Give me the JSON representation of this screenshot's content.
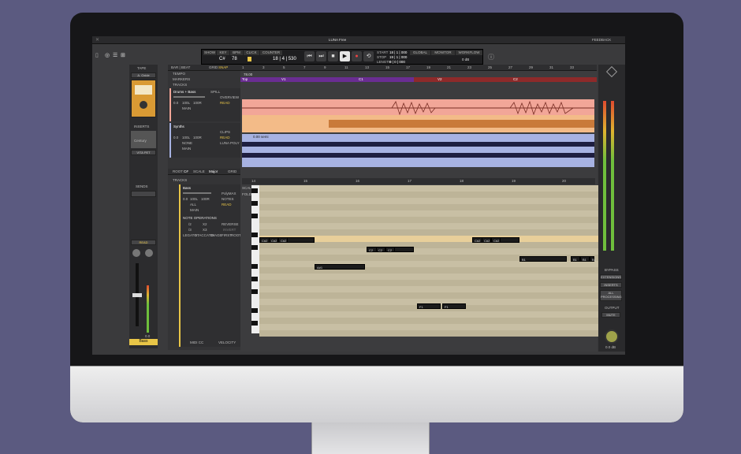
{
  "app": {
    "title": "LUNA Free",
    "feedback": "FEEDBACK"
  },
  "toolbar": {
    "tabs": [
      "SHOW",
      "KEY",
      "BPM",
      "CLICK",
      "COUNTER",
      "GLOBAL",
      "MONITOR",
      "WORKFLOW"
    ],
    "key": "C#",
    "bpm": "78",
    "counter": "18 | 4 | 530",
    "start_label": "START",
    "start_val": "18 | 1 | 000",
    "stop_label": "STOP",
    "stop_val": "19 | 1 | 000",
    "length_label": "LENGTH",
    "length_val": "0 | 0 | 000",
    "db": "0 dB"
  },
  "tape": {
    "label": "TAPE",
    "preset": "A. Oxide",
    "inserts": "INSERTS",
    "insert_name": "Century",
    "insert_sub": "VITA PET",
    "sends": "SENDS",
    "read": "READ",
    "track_name": "Bass",
    "value": "0.0"
  },
  "timeline": {
    "mode": "BAR | BEAT",
    "grid": "GRID",
    "snap": "SNAP",
    "bars_top": [
      "1",
      "3",
      "5",
      "7",
      "9",
      "11",
      "13",
      "15",
      "17",
      "19",
      "21",
      "23",
      "25",
      "27",
      "29",
      "31",
      "33"
    ],
    "tempo_label": "TEMPO",
    "tempo_val": "78.00",
    "markers_label": "MARKERS",
    "markers": [
      "Top",
      "V1",
      "C1",
      "V2",
      "C2"
    ],
    "tracks_label": "TRACKS"
  },
  "tracks": [
    {
      "name": "Drums + Bass",
      "spill": "SPILL",
      "view": "OVERVIEW",
      "auto": "READ",
      "out": "MAIN",
      "vol": "0.0",
      "pan": "100L",
      "pan2": "100R"
    },
    {
      "name": "Synths",
      "view": "CLIPS",
      "auto": "READ",
      "warp": "LUNA POLY",
      "vol": "0.0",
      "pan": "100L",
      "pan2": "100R",
      "in": "NONE",
      "out": "MAIN",
      "clip": "0.00 semi"
    }
  ],
  "editor": {
    "root_label": "ROOT",
    "root": "C#",
    "scale_label": "SCALE",
    "scale": "Major",
    "grid": "GRID",
    "grid_val": "16",
    "tracks": "TRACKS",
    "fold": "FOLD",
    "scale_btn": "SCALE",
    "bars": [
      "14",
      "15",
      "16",
      "17",
      "18",
      "19",
      "20"
    ],
    "track_name": "Bass",
    "instr": "PolyMAX",
    "view": "NOTES",
    "auto": "READ",
    "vol": "0.0",
    "pan": "100L",
    "pan2": "100R",
    "midi": "ALL",
    "out": "MAIN",
    "note_ops": "NOTE OPERATIONS",
    "reverse": "REVERSE",
    "invert": "INVERT",
    "ops_row": [
      "LEGATO",
      "STACCATO",
      "IMAGE",
      "FIRST",
      "ROOT"
    ],
    "x2": "X2",
    "div2": "/2",
    "x3": "X3",
    "div3": "/3",
    "midi_cc": "MIDI CC",
    "velocity": "VELOCITY",
    "notes": [
      {
        "label": "C#2",
        "row": 2
      },
      {
        "label": "C#2",
        "row": 2
      },
      {
        "label": "C#2",
        "row": 2
      },
      {
        "label": "C#2",
        "row": 2
      },
      {
        "label": "C#2",
        "row": 2
      },
      {
        "label": "C#2",
        "row": 2
      },
      {
        "label": "C2",
        "row": 3
      },
      {
        "label": "C2",
        "row": 3
      },
      {
        "label": "C2",
        "row": 3
      },
      {
        "label": "B1",
        "row": 4
      },
      {
        "label": "B1",
        "row": 4
      },
      {
        "label": "B1",
        "row": 4
      },
      {
        "label": "B1",
        "row": 4
      },
      {
        "label": "A#1",
        "row": 5
      },
      {
        "label": "F1",
        "row": 10
      },
      {
        "label": "F1",
        "row": 10
      }
    ]
  },
  "right": {
    "bypass": "BYPASS",
    "extensions": "EXTENSIONS",
    "inserts": "INSERTS",
    "all_processing": "ALL PROCESSING",
    "output": "OUTPUT",
    "mute": "MUTE",
    "gain": "0.0 dB"
  },
  "colors": {
    "drums": "#f2a698",
    "drums2": "#f3bb88",
    "synth": "#a7b2e2",
    "roll": "#c8bfa4",
    "accent": "#e8c547",
    "marker": "#7a3aa8",
    "marker_red": "#8e2a2a"
  }
}
